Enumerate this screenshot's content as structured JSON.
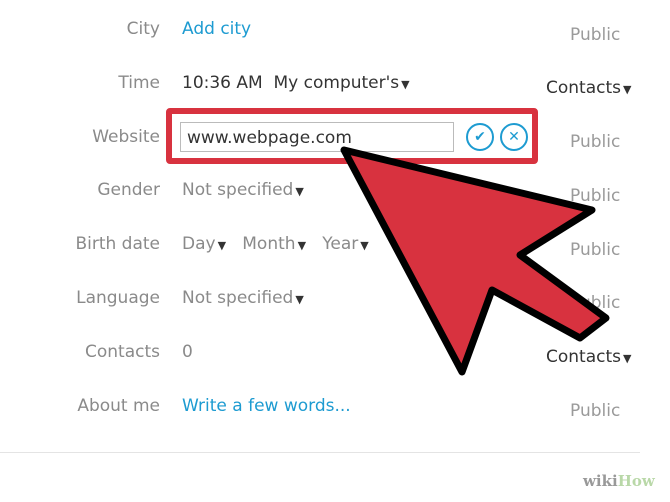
{
  "rows": [
    {
      "label": "City",
      "value": "Add city",
      "visibility": "Public"
    },
    {
      "label": "Time",
      "value": "10:36 AM",
      "value2": "My computer's",
      "visibility": "Contacts"
    },
    {
      "label": "Website",
      "value": "www.webpage.com",
      "visibility": "Public"
    },
    {
      "label": "Gender",
      "value": "Not specified",
      "visibility": "Public"
    },
    {
      "label": "Birth date",
      "day": "Day",
      "month": "Month",
      "year": "Year",
      "visibility": "Public"
    },
    {
      "label": "Language",
      "value": "Not specified",
      "visibility": "Public"
    },
    {
      "label": "Contacts",
      "value": "0",
      "visibility": "Contacts"
    },
    {
      "label": "About me",
      "value": "Write a few words...",
      "visibility": "Public"
    }
  ],
  "icons": {
    "confirm": "check-circle-icon",
    "cancel": "x-circle-icon",
    "annotation": "red-arrow"
  },
  "colors": {
    "accent": "#1d9bd1",
    "highlight": "#d8323f"
  },
  "watermark": {
    "wiki": "wiki",
    "how": "How"
  }
}
